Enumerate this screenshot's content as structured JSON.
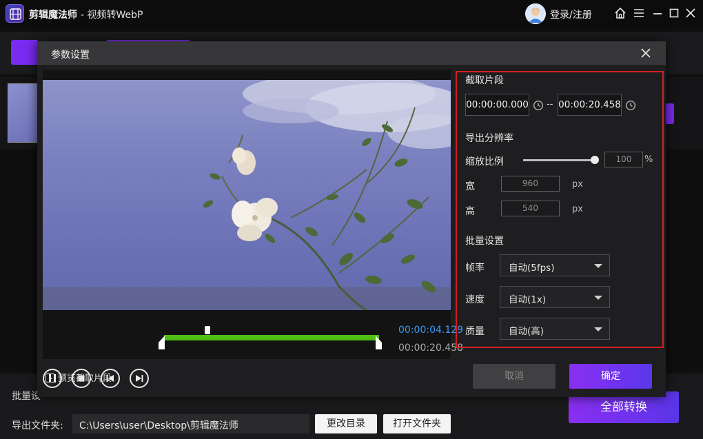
{
  "app": {
    "title": "剪辑魔法师",
    "subtitle": "- 视频转WebP",
    "login_label": "登录/注册"
  },
  "background": {
    "batch_label": "批量设",
    "export_label": "导出文件夹:",
    "export_path": "C:\\Users\\user\\Desktop\\剪辑魔法师",
    "change_dir_label": "更改目录",
    "open_folder_label": "打开文件夹",
    "convert_all_label": "全部转换"
  },
  "dialog": {
    "title": "参数设置",
    "player": {
      "current_time": "00:00:04.129",
      "total_time": "00:00:20.458",
      "preview_label": "预览截取片段"
    },
    "clip": {
      "section_title": "截取片段",
      "start_time": "00:00:00.000",
      "separator": "--",
      "end_time": "00:00:20.458"
    },
    "resolution": {
      "section_title": "导出分辨率",
      "scale_label": "缩放比例",
      "scale_value": "100",
      "scale_unit": "%",
      "scale_fraction": 1.0,
      "width_label": "宽",
      "width_value": "960",
      "height_label": "高",
      "height_value": "540",
      "px_unit": "px"
    },
    "batch": {
      "section_title": "批量设置",
      "fps_label": "帧率",
      "fps_value": "自动(5fps)",
      "speed_label": "速度",
      "speed_value": "自动(1x)",
      "quality_label": "质量",
      "quality_value": "自动(高)"
    },
    "cancel_label": "取消",
    "ok_label": "确定"
  },
  "colors": {
    "accent": "#7a2bf0",
    "highlight_border": "#d21f1f",
    "timeline": "#4fbe14",
    "current_time": "#3a9df7"
  }
}
